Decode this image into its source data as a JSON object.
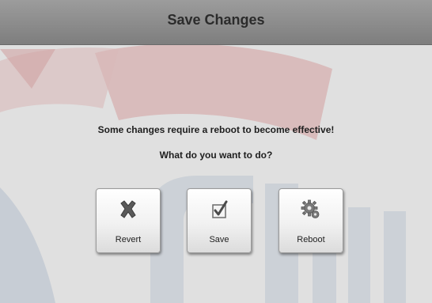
{
  "dialog": {
    "title": "Save Changes",
    "message_line1": "Some changes require a reboot to become effective!",
    "message_line2": "What do you want to do?"
  },
  "buttons": [
    {
      "label": "Revert",
      "icon": "x-mark-icon"
    },
    {
      "label": "Save",
      "icon": "checkmark-icon"
    },
    {
      "label": "Reboot",
      "icon": "gear-icon"
    }
  ],
  "colors": {
    "header": "#8a8a8a",
    "background": "#e0e0e0",
    "watermark_red": "#d2a8a8",
    "watermark_blue": "#a9b7c9"
  }
}
